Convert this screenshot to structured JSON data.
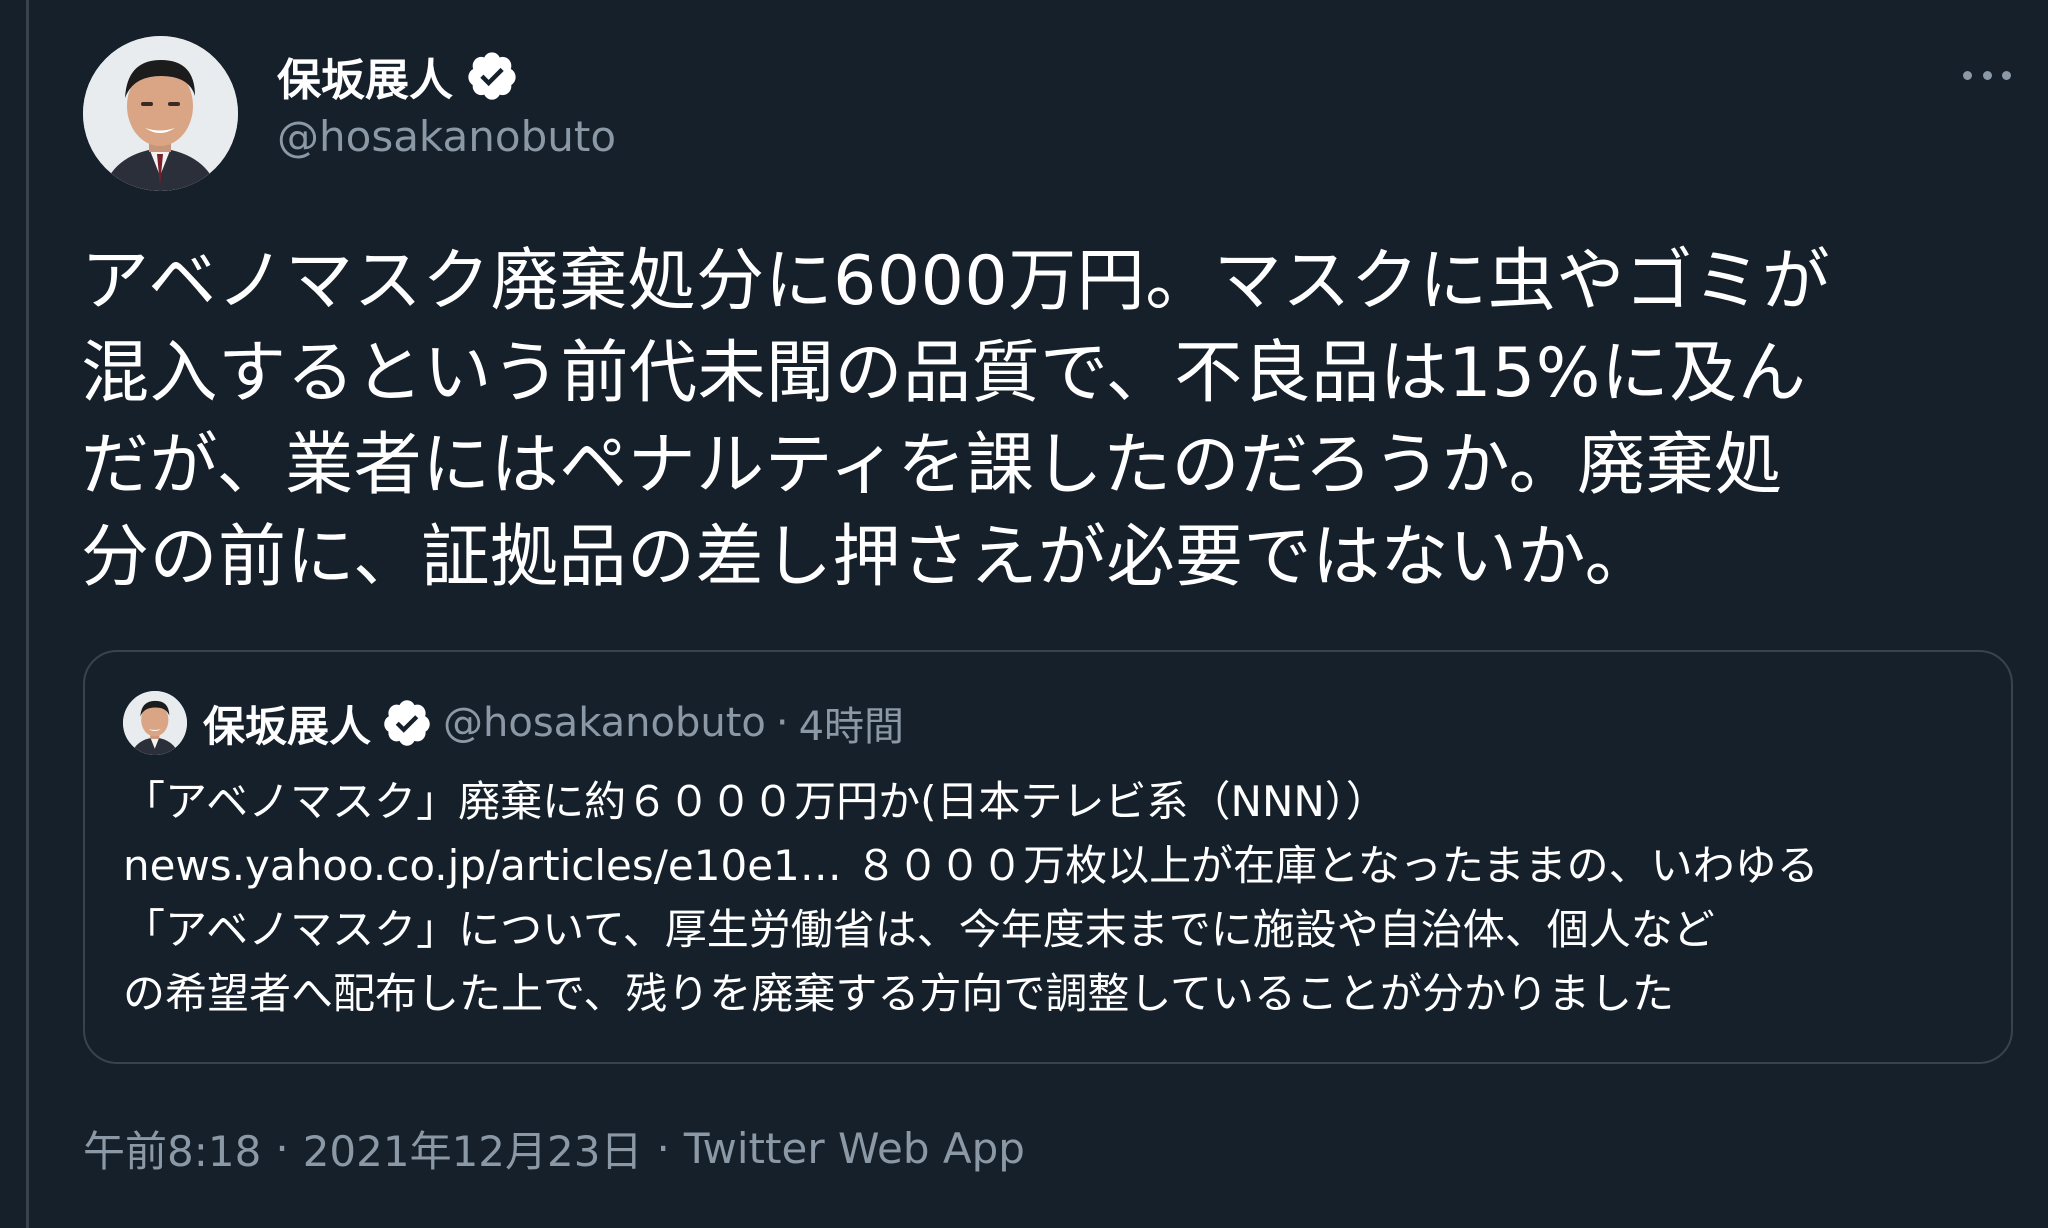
{
  "author": {
    "display_name": "保坂展人",
    "handle": "@hosakanobuto",
    "verified": true
  },
  "tweet": {
    "text_lines": [
      "アベノマスク廃棄処分に6000万円。マスクに虫やゴミが",
      "混入するという前代未聞の品質で、不良品は15%に及ん",
      "だが、業者にはペナルティを課したのだろうか。廃棄処",
      "分の前に、証拠品の差し押さえが必要ではないか。"
    ]
  },
  "quoted_tweet": {
    "display_name": "保坂展人",
    "handle": "@hosakanobuto",
    "separator": "·",
    "time": "4時間",
    "text_lines": [
      "「アベノマスク」廃棄に約６０００万円か(日本テレビ系（NNN））",
      "news.yahoo.co.jp/articles/e10e1… ８０００万枚以上が在庫となったままの、いわゆる",
      "「アベノマスク」について、厚生労働省は、今年度末までに施設や自治体、個人など",
      "の希望者へ配布した上で、残りを廃棄する方向で調整していることが分かりました"
    ]
  },
  "meta": {
    "time": "午前8:18",
    "separator": "·",
    "date": "2021年12月23日",
    "source": "Twitter Web App"
  },
  "icons": {
    "verified": "verified-badge-icon",
    "more": "more-horizontal-icon"
  },
  "colors": {
    "background": "#15202b",
    "text_primary": "#ffffff",
    "text_secondary": "#8b98a5",
    "border": "#38444d"
  }
}
